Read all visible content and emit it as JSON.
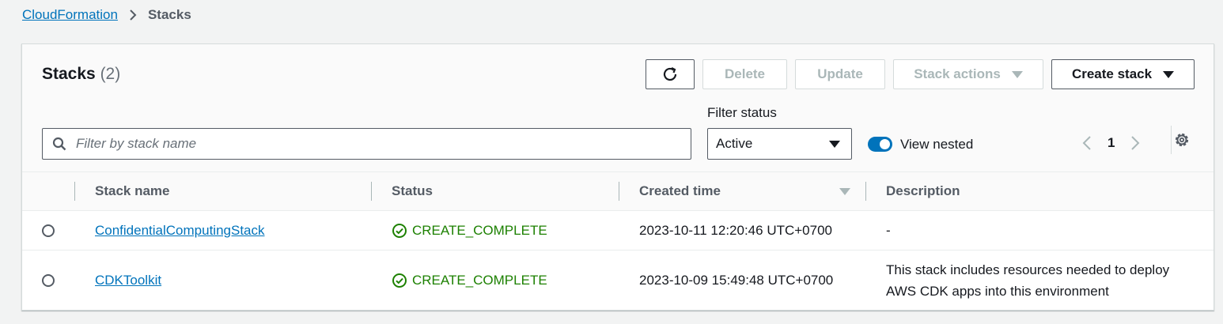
{
  "breadcrumb": {
    "parent": "CloudFormation",
    "current": "Stacks"
  },
  "header": {
    "title": "Stacks",
    "count": "(2)",
    "buttons": {
      "delete": "Delete",
      "update": "Update",
      "stack_actions": "Stack actions",
      "create_stack": "Create stack"
    }
  },
  "filters": {
    "search_placeholder": "Filter by stack name",
    "status_label": "Filter status",
    "status_value": "Active",
    "view_nested_label": "View nested",
    "view_nested_on": true,
    "page": "1"
  },
  "table": {
    "columns": [
      "Stack name",
      "Status",
      "Created time",
      "Description"
    ],
    "rows": [
      {
        "name": "ConfidentialComputingStack",
        "status": "CREATE_COMPLETE",
        "created": "2023-10-11 12:20:46 UTC+0700",
        "description": "-"
      },
      {
        "name": "CDKToolkit",
        "status": "CREATE_COMPLETE",
        "created": "2023-10-09 15:49:48 UTC+0700",
        "description": "This stack includes resources needed to deploy AWS CDK apps into this environment"
      }
    ]
  },
  "colors": {
    "link": "#0073bb",
    "success": "#1d8102",
    "toggle_on": "#0073bb"
  }
}
